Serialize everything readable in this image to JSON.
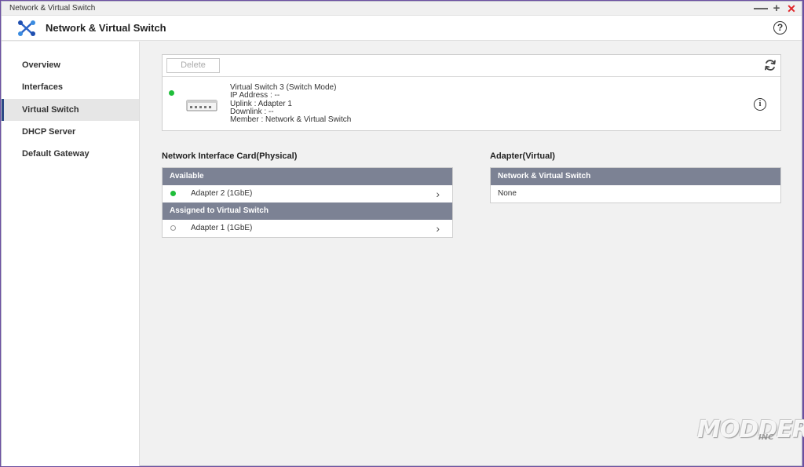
{
  "window": {
    "title": "Network & Virtual Switch",
    "minimize": "—",
    "maximize": "+",
    "close": "✕"
  },
  "header": {
    "app_title": "Network & Virtual Switch",
    "help": "?"
  },
  "sidebar": {
    "items": [
      {
        "label": "Overview",
        "active": false
      },
      {
        "label": "Interfaces",
        "active": false
      },
      {
        "label": "Virtual Switch",
        "active": true
      },
      {
        "label": "DHCP Server",
        "active": false
      },
      {
        "label": "Default Gateway",
        "active": false
      }
    ]
  },
  "switch_card": {
    "delete_label": "Delete",
    "status": "online",
    "name": "Virtual Switch 3 (Switch Mode)",
    "ip_address": "IP Address : --",
    "uplink": "Uplink : Adapter 1",
    "downlink": "Downlink : --",
    "member": "Member : Network & Virtual Switch",
    "info": "i"
  },
  "nic_section": {
    "title": "Network Interface Card(Physical)",
    "available_header": "Available",
    "available": [
      {
        "label": "Adapter 2 (1GbE)",
        "status": "connected"
      }
    ],
    "assigned_header": "Assigned to Virtual Switch",
    "assigned": [
      {
        "label": "Adapter 1 (1GbE)",
        "status": "disconnected"
      }
    ],
    "chevron": "›"
  },
  "adapter_section": {
    "title": "Adapter(Virtual)",
    "header": "Network & Virtual Switch",
    "value": "None"
  },
  "watermark": {
    "brand": "MODDERS",
    "suffix": "INC"
  },
  "colors": {
    "accent": "#2c4a86",
    "status_green": "#1fbe3a",
    "table_header": "#7c8294",
    "close_red": "#e0262a"
  }
}
